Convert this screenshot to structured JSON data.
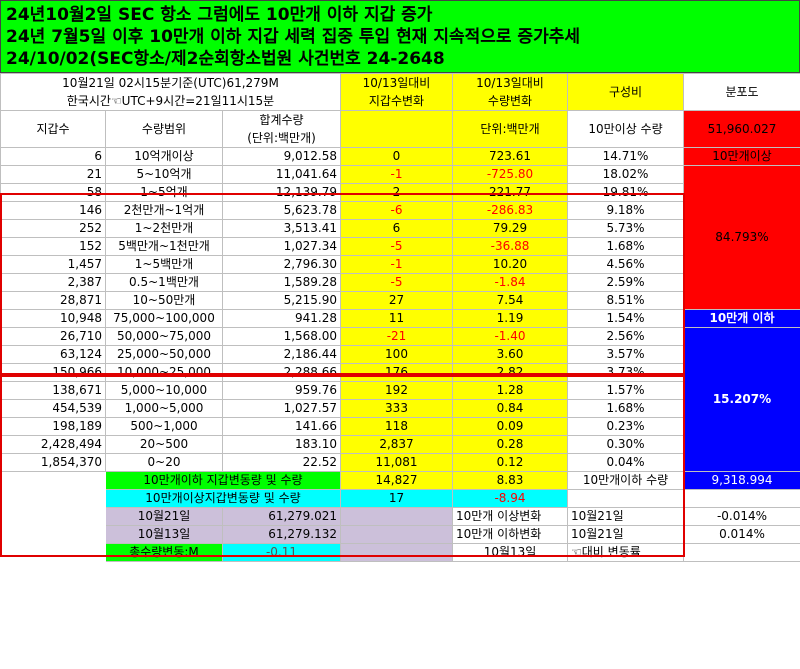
{
  "header": {
    "line1": "24년10월2일 SEC 항소 그럼에도  10만개 이하 지갑 증가",
    "line2": "24년 7월5일 이후  10만개 이하 지갑  세력 집중 투입  현재 지속적으로 증가추세",
    "line3": "24/10/02(SEC항소/제2순회항소법원 사건번호 24-2648"
  },
  "top": {
    "basis1": "10월21일 02시15분기준(UTC)61,279M",
    "basis2": "한국시간☜UTC+9시간=21일11시15분",
    "col_wallet_change1": "10/13일대비",
    "col_wallet_change2": "지갑수변화",
    "col_qty_change1": "10/13일대비",
    "col_qty_change2": "수량변화",
    "col_ratio": "구성비",
    "col_dist": "분포도"
  },
  "sub": {
    "wallets": "지갑수",
    "range": "수량범위",
    "total1": "합계수량",
    "total2": "(단위:백만개)",
    "unit": "단위:백만개",
    "over_label": "10만이상 수량",
    "over_value": "51,960.027"
  },
  "rows": [
    {
      "wallets": "6",
      "range": "10억개이상",
      "total": "9,012.58",
      "wchg": "0",
      "qchg": "723.61",
      "ratio": "14.71%",
      "neg": false
    },
    {
      "wallets": "21",
      "range": "5~10억개",
      "total": "11,041.64",
      "wchg": "-1",
      "qchg": "-725.80",
      "ratio": "18.02%",
      "neg": true
    },
    {
      "wallets": "58",
      "range": "1~5억개",
      "total": "12,139.79",
      "wchg": "2",
      "qchg": "221.77",
      "ratio": "19.81%",
      "neg": false
    },
    {
      "wallets": "146",
      "range": "2천만개~1억개",
      "total": "5,623.78",
      "wchg": "-6",
      "qchg": "-286.83",
      "ratio": "9.18%",
      "neg": true
    },
    {
      "wallets": "252",
      "range": "1~2천만개",
      "total": "3,513.41",
      "wchg": "6",
      "qchg": "79.29",
      "ratio": "5.73%",
      "neg": false
    },
    {
      "wallets": "152",
      "range": "5백만개~1천만개",
      "total": "1,027.34",
      "wchg": "-5",
      "qchg": "-36.88",
      "ratio": "1.68%",
      "neg": true
    },
    {
      "wallets": "1,457",
      "range": "1~5백만개",
      "total": "2,796.30",
      "wchg": "-1",
      "qchg": "10.20",
      "ratio": "4.56%",
      "neg": true,
      "qpos": true
    },
    {
      "wallets": "2,387",
      "range": "0.5~1백만개",
      "total": "1,589.28",
      "wchg": "-5",
      "qchg": "-1.84",
      "ratio": "2.59%",
      "neg": true
    },
    {
      "wallets": "28,871",
      "range": "10~50만개",
      "total": "5,215.90",
      "wchg": "27",
      "qchg": "7.54",
      "ratio": "8.51%",
      "neg": false
    },
    {
      "wallets": "10,948",
      "range": "75,000~100,000",
      "total": "941.28",
      "wchg": "11",
      "qchg": "1.19",
      "ratio": "1.54%",
      "neg": false
    },
    {
      "wallets": "26,710",
      "range": "50,000~75,000",
      "total": "1,568.00",
      "wchg": "-21",
      "qchg": "-1.40",
      "ratio": "2.56%",
      "neg": true
    },
    {
      "wallets": "63,124",
      "range": "25,000~50,000",
      "total": "2,186.44",
      "wchg": "100",
      "qchg": "3.60",
      "ratio": "3.57%",
      "neg": false
    },
    {
      "wallets": "150,966",
      "range": "10,000~25,000",
      "total": "2,288.66",
      "wchg": "176",
      "qchg": "2.82",
      "ratio": "3.73%",
      "neg": false
    },
    {
      "wallets": "138,671",
      "range": "5,000~10,000",
      "total": "959.76",
      "wchg": "192",
      "qchg": "1.28",
      "ratio": "1.57%",
      "neg": false
    },
    {
      "wallets": "454,539",
      "range": "1,000~5,000",
      "total": "1,027.57",
      "wchg": "333",
      "qchg": "0.84",
      "ratio": "1.68%",
      "neg": false
    },
    {
      "wallets": "198,189",
      "range": "500~1,000",
      "total": "141.66",
      "wchg": "118",
      "qchg": "0.09",
      "ratio": "0.23%",
      "neg": false
    },
    {
      "wallets": "2,428,494",
      "range": "20~500",
      "total": "183.10",
      "wchg": "2,837",
      "qchg": "0.28",
      "ratio": "0.30%",
      "neg": false
    },
    {
      "wallets": "1,854,370",
      "range": "0~20",
      "total": "22.52",
      "wchg": "11,081",
      "qchg": "0.12",
      "ratio": "0.04%",
      "neg": false
    }
  ],
  "dist": {
    "over_title": "10만개이상",
    "over_pct": "84.793%",
    "under_title": "10만개 이하",
    "under_pct": "15.207%"
  },
  "bottom": {
    "under_label": "10만개이하 지갑변동량 및 수량",
    "under_wchg": "14,827",
    "under_qchg": "8.83",
    "under_qty_label": "10만개이하 수량",
    "under_qty_value": "9,318.994",
    "over_label": "10만개이상지갑변동량 및 수량",
    "over_wchg": "17",
    "over_qchg": "-8.94",
    "d1_label": "10월21일",
    "d1_value": "61,279.021",
    "d2_label": "10월13일",
    "d2_value": "61,279.132",
    "total_label": "총수량변동:M",
    "total_value": "-0.11",
    "over_change_label": "10만개 이상변화",
    "over_change_date": "10월21일",
    "over_change_value": "-0.014%",
    "under_change_label": "10만개 이하변화",
    "under_change_date": "10월21일",
    "under_change_value": "0.014%",
    "foot_date": "10월13일",
    "foot_note": "☜대비 변동률"
  },
  "colors": {
    "green": "#00ff00",
    "yellow": "#ffff00",
    "red": "#ff0000",
    "blue": "#0000ff",
    "cyan": "#00ffff",
    "lavender": "#ccc0da"
  }
}
